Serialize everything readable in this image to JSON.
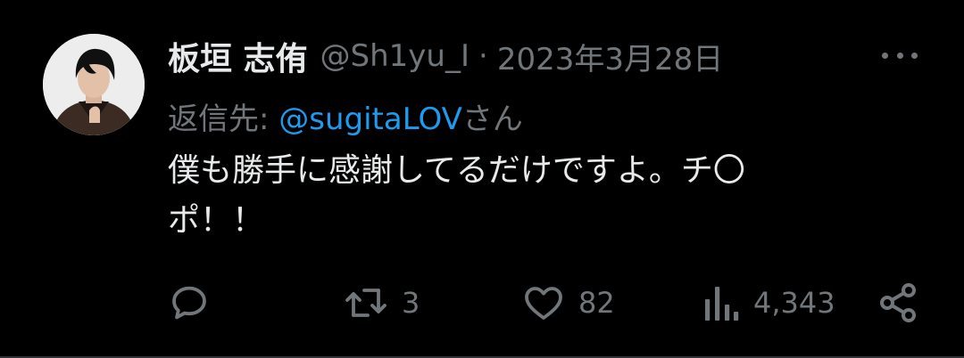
{
  "tweet": {
    "author": {
      "display_name": "板垣 志侑",
      "handle": "@Sh1yu_I"
    },
    "separator": "·",
    "date": "2023年3月28日",
    "reply": {
      "label": "返信先: ",
      "handle": "@sugitaLOV",
      "suffix": "さん"
    },
    "text_lines": [
      "僕も勝手に感謝してるだけですよ。チ〇",
      "ポ！！"
    ],
    "stats": {
      "replies": "",
      "retweets": "3",
      "likes": "82",
      "views": "4,343"
    }
  },
  "icons": {
    "avatar": "profile-photo",
    "more": "more-dots-icon",
    "reply": "reply-bubble-icon",
    "retweet": "retweet-icon",
    "like": "heart-icon",
    "views": "bar-chart-icon",
    "share": "share-icon"
  },
  "colors": {
    "background": "#000000",
    "primary_text": "#e7e9ea",
    "secondary_text": "#71767b",
    "link": "#1d9bf0"
  }
}
